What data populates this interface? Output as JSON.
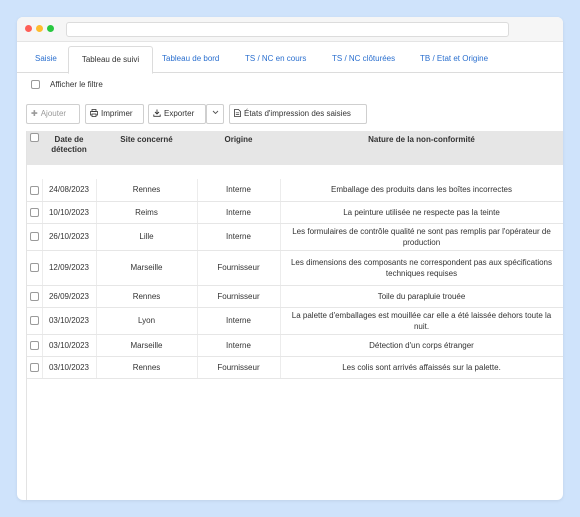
{
  "tabs": [
    {
      "label": "Saisie"
    },
    {
      "label": "Tableau de suivi"
    },
    {
      "label": "Tableau de bord"
    },
    {
      "label": "TS / NC en cours"
    },
    {
      "label": "TS / NC clôturées"
    },
    {
      "label": "TB / Etat et Origine"
    }
  ],
  "filter": {
    "label": "Afficher le filtre"
  },
  "toolbar": {
    "add": "Ajouter",
    "print": "Imprimer",
    "export": "Exporter",
    "states": "États d'impression des saisies"
  },
  "table": {
    "headers": {
      "date": "Date de détection",
      "site": "Site concerné",
      "origin": "Origine",
      "nature": "Nature de la non-conformité"
    },
    "rows": [
      {
        "date": "24/08/2023",
        "site": "Rennes",
        "origin": "Interne",
        "nature": "Emballage des produits dans les boîtes incorrectes"
      },
      {
        "date": "10/10/2023",
        "site": "Reims",
        "origin": "Interne",
        "nature": "La peinture utilisée ne respecte pas la teinte"
      },
      {
        "date": "26/10/2023",
        "site": "Lille",
        "origin": "Interne",
        "nature": "Les formulaires de contrôle qualité ne sont pas remplis par l'opérateur de production"
      },
      {
        "date": "12/09/2023",
        "site": "Marseille",
        "origin": "Fournisseur",
        "nature": "Les dimensions des composants ne correspondent pas aux spécifications techniques requises"
      },
      {
        "date": "26/09/2023",
        "site": "Rennes",
        "origin": "Fournisseur",
        "nature": "Toile du parapluie trouée"
      },
      {
        "date": "03/10/2023",
        "site": "Lyon",
        "origin": "Interne",
        "nature": "La palette d'emballages est mouillée car elle a été laissée dehors toute la nuit."
      },
      {
        "date": "03/10/2023",
        "site": "Marseille",
        "origin": "Interne",
        "nature": "Détection d'un corps étranger"
      },
      {
        "date": "03/10/2023",
        "site": "Rennes",
        "origin": "Fournisseur",
        "nature": "Les colis sont arrivés affaissés sur la palette."
      }
    ]
  }
}
